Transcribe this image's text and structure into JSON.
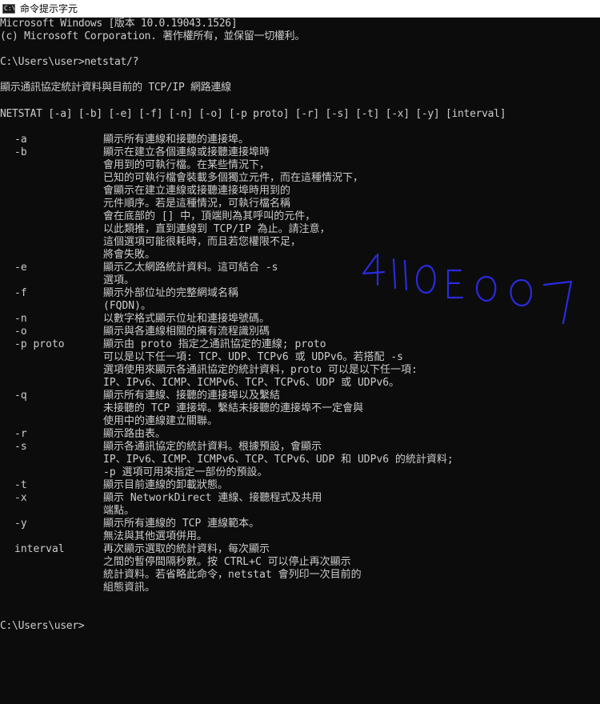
{
  "window": {
    "title": "命令提示字元",
    "icon_label": "C:\\"
  },
  "console": {
    "header1": "Microsoft Windows [版本 10.0.19043.1526]",
    "header2": "(c) Microsoft Corporation. 著作權所有，並保留一切權利。",
    "command": "C:\\Users\\user>netstat/?",
    "description": "顯示通訊協定統計資料與目前的 TCP/IP 網路連線",
    "usage": "NETSTAT [-a] [-b] [-e] [-f] [-n] [-o] [-p proto] [-r] [-s] [-t] [-x] [-y] [interval]",
    "options": [
      {
        "flag": "-a",
        "lines": [
          "顯示所有連線和接聽的連接埠。"
        ]
      },
      {
        "flag": "-b",
        "lines": [
          "顯示在建立各個連線或接聽連接埠時",
          "會用到的可執行檔。在某些情況下，",
          "已知的可執行檔會裝載多個獨立元件，而在這種情況下，",
          "會顯示在建立連線或接聽連接埠時用到的",
          "元件順序。若是這種情況，可執行檔名稱",
          "會在底部的 [] 中，頂端則為其呼叫的元件，",
          "以此類推，直到連線到 TCP/IP 為止。請注意，",
          "這個選項可能很耗時，而且若您權限不足，",
          "將會失敗。"
        ]
      },
      {
        "flag": "-e",
        "lines": [
          "顯示乙太網路統計資料。這可結合 -s",
          "選項。"
        ]
      },
      {
        "flag": "-f",
        "lines": [
          "顯示外部位址的完整網域名稱",
          "(FQDN)。"
        ]
      },
      {
        "flag": "-n",
        "lines": [
          "以數字格式顯示位址和連接埠號碼。"
        ]
      },
      {
        "flag": "-o",
        "lines": [
          "顯示與各連線相關的擁有流程識別碼"
        ]
      },
      {
        "flag": "-p proto",
        "lines": [
          "顯示由 proto 指定之通訊協定的連線; proto",
          "可以是以下任一項: TCP、UDP、TCPv6 或 UDPv6。若搭配 -s",
          "選項使用來顯示各通訊協定的統計資料，proto 可以是以下任一項:",
          "IP、IPv6、ICMP、ICMPv6、TCP、TCPv6、UDP 或 UDPv6。"
        ]
      },
      {
        "flag": "-q",
        "lines": [
          "顯示所有連線、接聽的連接埠以及繫結",
          "未接聽的 TCP 連接埠。繫結未接聽的連接埠不一定會與",
          "使用中的連線建立關聯。"
        ]
      },
      {
        "flag": "-r",
        "lines": [
          "顯示路由表。"
        ]
      },
      {
        "flag": "-s",
        "lines": [
          "顯示各通訊協定的統計資料。根據預設，會顯示",
          "IP、IPv6、ICMP、ICMPv6、TCP、TCPv6、UDP 和 UDPv6 的統計資料;",
          "-p 選項可用來指定一部份的預設。"
        ]
      },
      {
        "flag": "-t",
        "lines": [
          "顯示目前連線的卸載狀態。"
        ]
      },
      {
        "flag": "-x",
        "lines": [
          "顯示 NetworkDirect 連線、接聽程式及共用",
          "端點。"
        ]
      },
      {
        "flag": "-y",
        "lines": [
          "顯示所有連線的 TCP 連線範本。",
          "無法與其他選項併用。"
        ]
      },
      {
        "flag": "interval",
        "lines": [
          "再次顯示選取的統計資料，每次顯示",
          "之間的暫停間隔秒數。按 CTRL+C 可以停止再次顯示",
          "統計資料。若省略此命令，netstat 會列印一次目前的",
          "組態資訊。"
        ]
      }
    ],
    "prompt": "C:\\Users\\user>"
  },
  "annotation": {
    "text": "4110E007",
    "color": "#2a2ae0"
  },
  "colors": {
    "background": "#0c0c0c",
    "text": "#cccccc",
    "titlebar": "#ffffff"
  }
}
